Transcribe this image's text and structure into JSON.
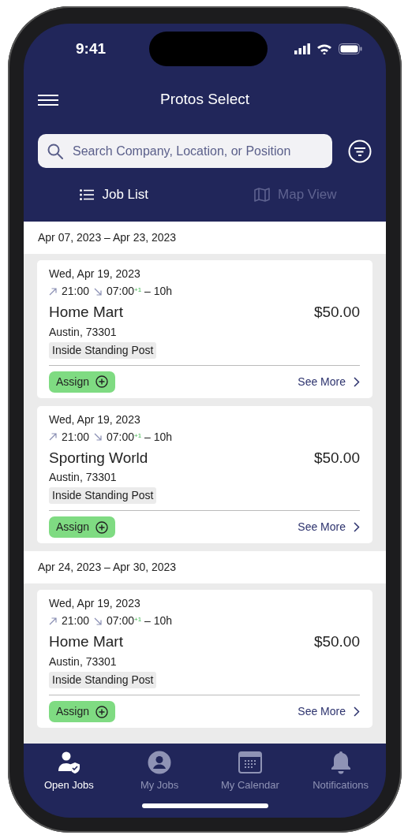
{
  "status_bar": {
    "time": "9:41"
  },
  "header": {
    "title": "Protos Select"
  },
  "search": {
    "placeholder": "Search Company, Location, or Position"
  },
  "view_tabs": [
    {
      "label": "Job List",
      "kind": "list",
      "selected": true
    },
    {
      "label": "Map View",
      "kind": "map",
      "selected": false
    }
  ],
  "groups": [
    {
      "range": "Apr 07, 2023 – Apr 23, 2023",
      "jobs": [
        {
          "date": "Wed, Apr 19, 2023",
          "start": "21:00",
          "end": "07:00$^{+1}$ – 10h",
          "company": "Home Mart",
          "price": "$50.00",
          "location": "Austin, 73301",
          "tag": "Inside Standing Post",
          "assign": "Assign",
          "see_more": "See More"
        },
        {
          "date": "Wed, Apr 19, 2023",
          "start": "21:00",
          "end": "07:00$^{+1}$ – 10h",
          "company": "Sporting World",
          "price": "$50.00",
          "location": "Austin, 73301",
          "tag": "Inside Standing Post",
          "assign": "Assign",
          "see_more": "See More"
        }
      ]
    },
    {
      "range": "Apr 24, 2023 – Apr 30, 2023",
      "jobs": [
        {
          "date": "Wed, Apr 19, 2023",
          "start": "21:00",
          "end": "07:00$^{+1}$ – 10h",
          "company": "Home Mart",
          "price": "$50.00",
          "location": "Austin, 73301",
          "tag": "Inside Standing Post",
          "assign": "Assign",
          "see_more": "See More"
        }
      ]
    }
  ],
  "bottom_nav": [
    {
      "label": "Open Jobs",
      "kind": "open-jobs",
      "selected": true
    },
    {
      "label": "My Jobs",
      "kind": "profile",
      "selected": false
    },
    {
      "label": "My Calendar",
      "kind": "calendar",
      "selected": false
    },
    {
      "label": "Notifications",
      "kind": "bell",
      "selected": false
    }
  ]
}
